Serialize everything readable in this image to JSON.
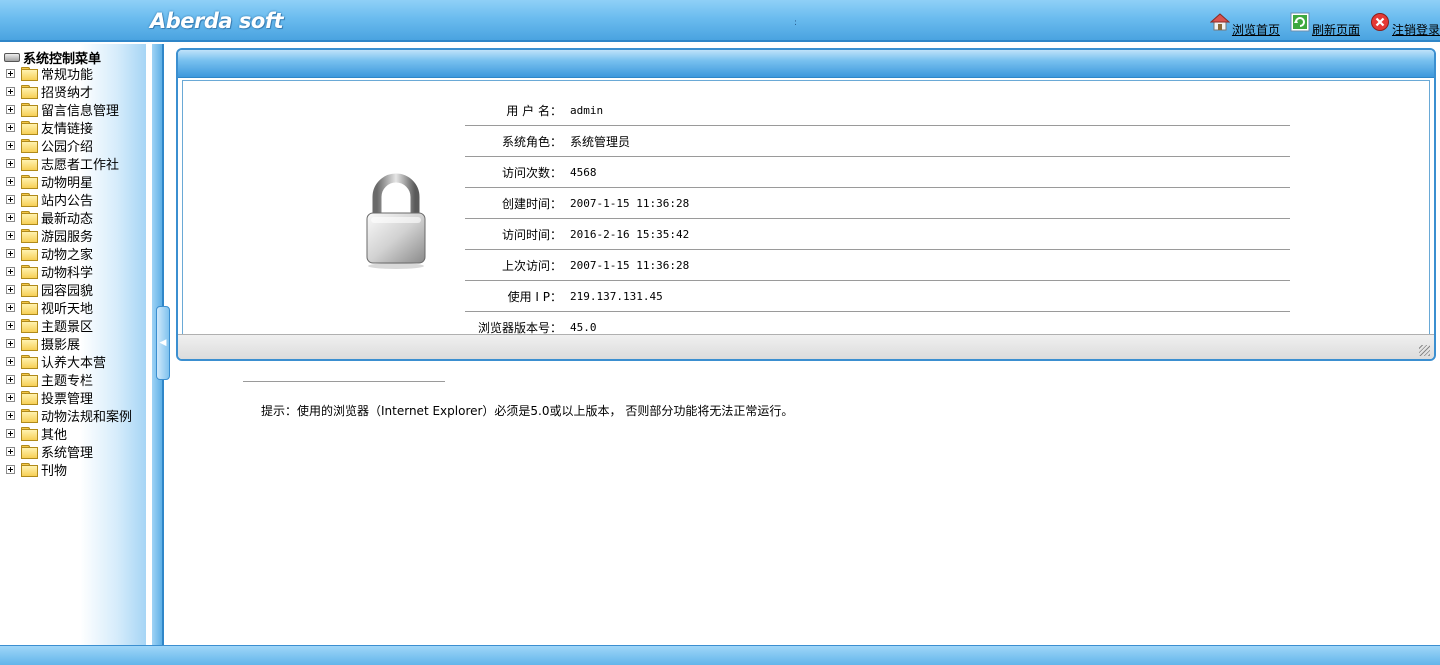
{
  "header": {
    "logo": "Aberda soft",
    "links": [
      {
        "label": "浏览首页",
        "icon": "home-icon"
      },
      {
        "label": "刷新页面",
        "icon": "refresh-icon"
      },
      {
        "label": "注销登录",
        "icon": "logout-icon"
      }
    ]
  },
  "sidebar": {
    "title": "系统控制菜单",
    "items": [
      "常规功能",
      "招贤纳才",
      "留言信息管理",
      "友情链接",
      "公园介绍",
      "志愿者工作社",
      "动物明星",
      "站内公告",
      "最新动态",
      "游园服务",
      "动物之家",
      "动物科学",
      "园容园貌",
      "视听天地",
      "主题景区",
      "摄影展",
      "认养大本营",
      "主题专栏",
      "投票管理",
      "动物法规和案例",
      "其他",
      "系统管理",
      "刊物"
    ]
  },
  "info": {
    "rows": [
      {
        "label": "用 户 名：",
        "value": "admin",
        "cn": false
      },
      {
        "label": "系统角色：",
        "value": "系统管理员",
        "cn": true
      },
      {
        "label": "访问次数：",
        "value": "4568",
        "cn": false
      },
      {
        "label": "创建时间：",
        "value": "2007-1-15 11:36:28",
        "cn": false
      },
      {
        "label": "访问时间：",
        "value": "2016-2-16 15:35:42",
        "cn": false
      },
      {
        "label": "上次访问：",
        "value": "2007-1-15 11:36:28",
        "cn": false
      },
      {
        "label": "使用 I P：",
        "value": "219.137.131.45",
        "cn": false
      },
      {
        "label": "浏览器版本号：",
        "value": "45.0",
        "cn": false
      }
    ]
  },
  "hint": "提示：使用的浏览器（Internet Explorer）必须是5.0或以上版本， 否则部分功能将无法正常运行。"
}
